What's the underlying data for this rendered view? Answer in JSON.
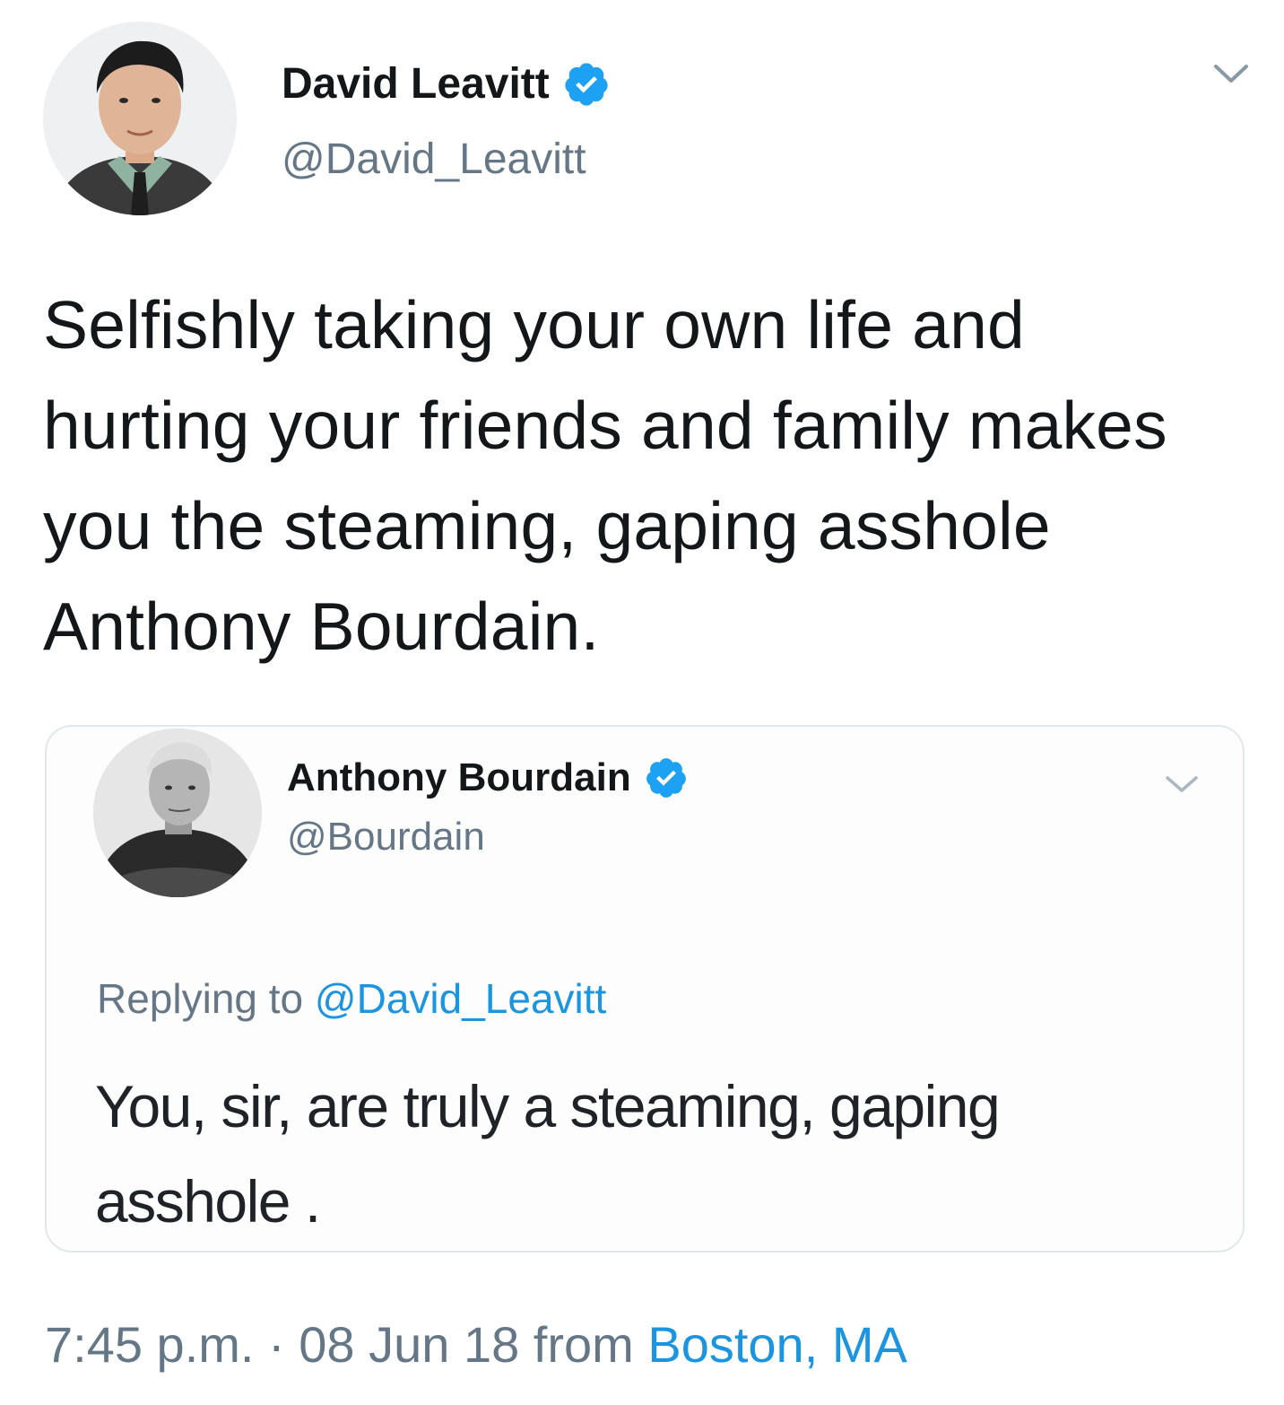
{
  "tweet": {
    "author": {
      "name": "David Leavitt",
      "handle": "@David_Leavitt",
      "verified": true,
      "avatar": "profile-photo"
    },
    "text": "Selfishly taking your own life and hurting your friends and family makes you the steaming, gaping asshole Anthony Bourdain.",
    "time": "7:45 p.m.",
    "separator": "·",
    "date": "08 Jun 18",
    "source_prefix": "from",
    "location": "Boston, MA",
    "menu_icon": "chevron-down-icon"
  },
  "quoted_tweet": {
    "author": {
      "name": "Anthony Bourdain",
      "handle": "@Bourdain",
      "verified": true,
      "avatar": "profile-photo-bw"
    },
    "replying_prefix": "Replying to",
    "replying_to": "@David_Leavitt",
    "text": "You, sir, are truly a steaming, gaping asshole .",
    "menu_icon": "chevron-down-icon"
  },
  "colors": {
    "text": "#14171a",
    "secondary": "#657786",
    "link": "#1b95e0",
    "verified": "#1da1f2",
    "card_border": "#e1e8ed"
  }
}
